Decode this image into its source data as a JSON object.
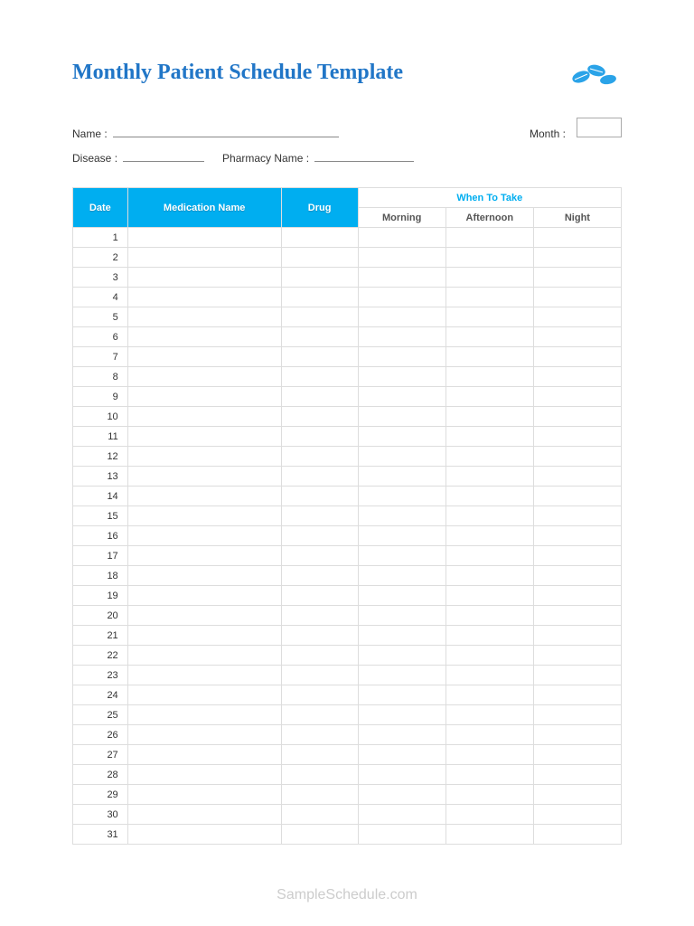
{
  "title": "Monthly Patient Schedule Template",
  "form": {
    "name_label": "Name :",
    "month_label": "Month :",
    "disease_label": "Disease :",
    "pharmacy_label": "Pharmacy Name :"
  },
  "table": {
    "headers": {
      "date": "Date",
      "medication": "Medication Name",
      "drug": "Drug",
      "when": "When To Take",
      "morning": "Morning",
      "afternoon": "Afternoon",
      "night": "Night"
    },
    "rows": [
      "1",
      "2",
      "3",
      "4",
      "5",
      "6",
      "7",
      "8",
      "9",
      "10",
      "11",
      "12",
      "13",
      "14",
      "15",
      "16",
      "17",
      "18",
      "19",
      "20",
      "21",
      "22",
      "23",
      "24",
      "25",
      "26",
      "27",
      "28",
      "29",
      "30",
      "31"
    ]
  },
  "watermark": "SampleSchedule.com"
}
